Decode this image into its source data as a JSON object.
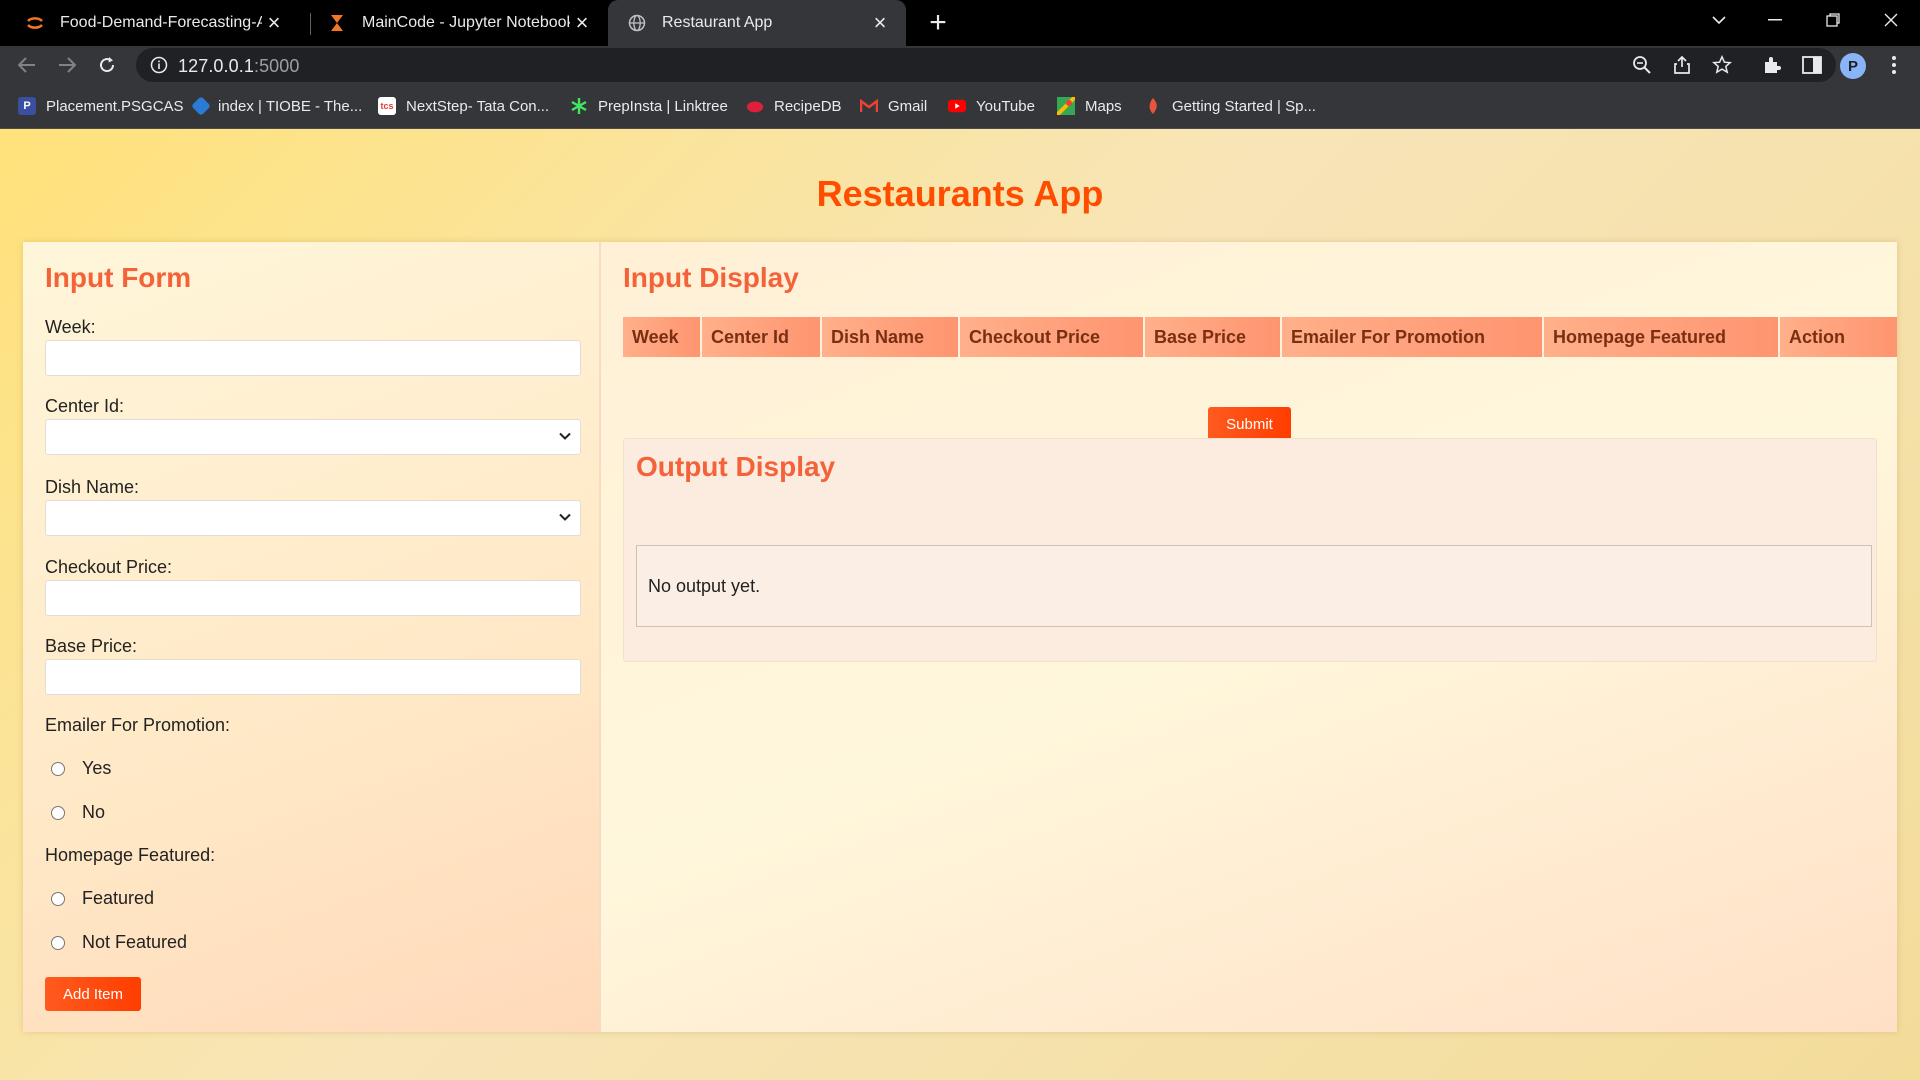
{
  "browser": {
    "tabs": [
      {
        "title": "Food-Demand-Forecasting-And-",
        "icon": "jupyter-icon",
        "active": false
      },
      {
        "title": "MainCode - Jupyter Notebook",
        "icon": "hourglass-icon",
        "active": false
      },
      {
        "title": "Restaurant App",
        "icon": "globe-icon",
        "active": true
      }
    ],
    "url_host": "127.0.0.1",
    "url_port": ":5000",
    "profile_initial": "P",
    "bookmarks": [
      {
        "label": "Placement.PSGCAS",
        "icon": "psg-icon",
        "color": "#3a4fa0"
      },
      {
        "label": "index | TIOBE - The...",
        "icon": "tiobe-icon",
        "color": "#2b7bd6"
      },
      {
        "label": "NextStep- Tata Con...",
        "icon": "tcs-icon",
        "color": "#e03a3a"
      },
      {
        "label": "PrepInsta | Linktree",
        "icon": "linktree-icon",
        "color": "#43e660"
      },
      {
        "label": "RecipeDB",
        "icon": "recipedb-icon",
        "color": "#e0203a"
      },
      {
        "label": "Gmail",
        "icon": "gmail-icon",
        "color": "#ea4335"
      },
      {
        "label": "YouTube",
        "icon": "youtube-icon",
        "color": "#ff0000"
      },
      {
        "label": "Maps",
        "icon": "maps-icon",
        "color": "#34a853"
      },
      {
        "label": "Getting Started | Sp...",
        "icon": "spring-icon",
        "color": "#e8553a"
      }
    ]
  },
  "page": {
    "app_title": "Restaurants App",
    "input_form": {
      "title": "Input Form",
      "week_label": "Week:",
      "week_value": "",
      "center_label": "Center Id:",
      "center_value": "",
      "dish_label": "Dish Name:",
      "dish_value": "",
      "checkout_label": "Checkout Price:",
      "checkout_value": "",
      "base_label": "Base Price:",
      "base_value": "",
      "emailer_label": "Emailer For Promotion:",
      "emailer_options": [
        "Yes",
        "No"
      ],
      "homepage_label": "Homepage Featured:",
      "homepage_options": [
        "Featured",
        "Not Featured"
      ],
      "add_button": "Add Item"
    },
    "input_display": {
      "title": "Input Display",
      "columns": [
        "Week",
        "Center Id",
        "Dish Name",
        "Checkout Price",
        "Base Price",
        "Emailer For Promotion",
        "Homepage Featured",
        "Action"
      ],
      "rows": [],
      "submit_button": "Submit"
    },
    "output_display": {
      "title": "Output Display",
      "text": "No output yet."
    }
  },
  "colors": {
    "accent": "#ff4d00",
    "section_title": "#f4623a",
    "button": "#ff4a14",
    "table_header": "#ffa07c"
  }
}
